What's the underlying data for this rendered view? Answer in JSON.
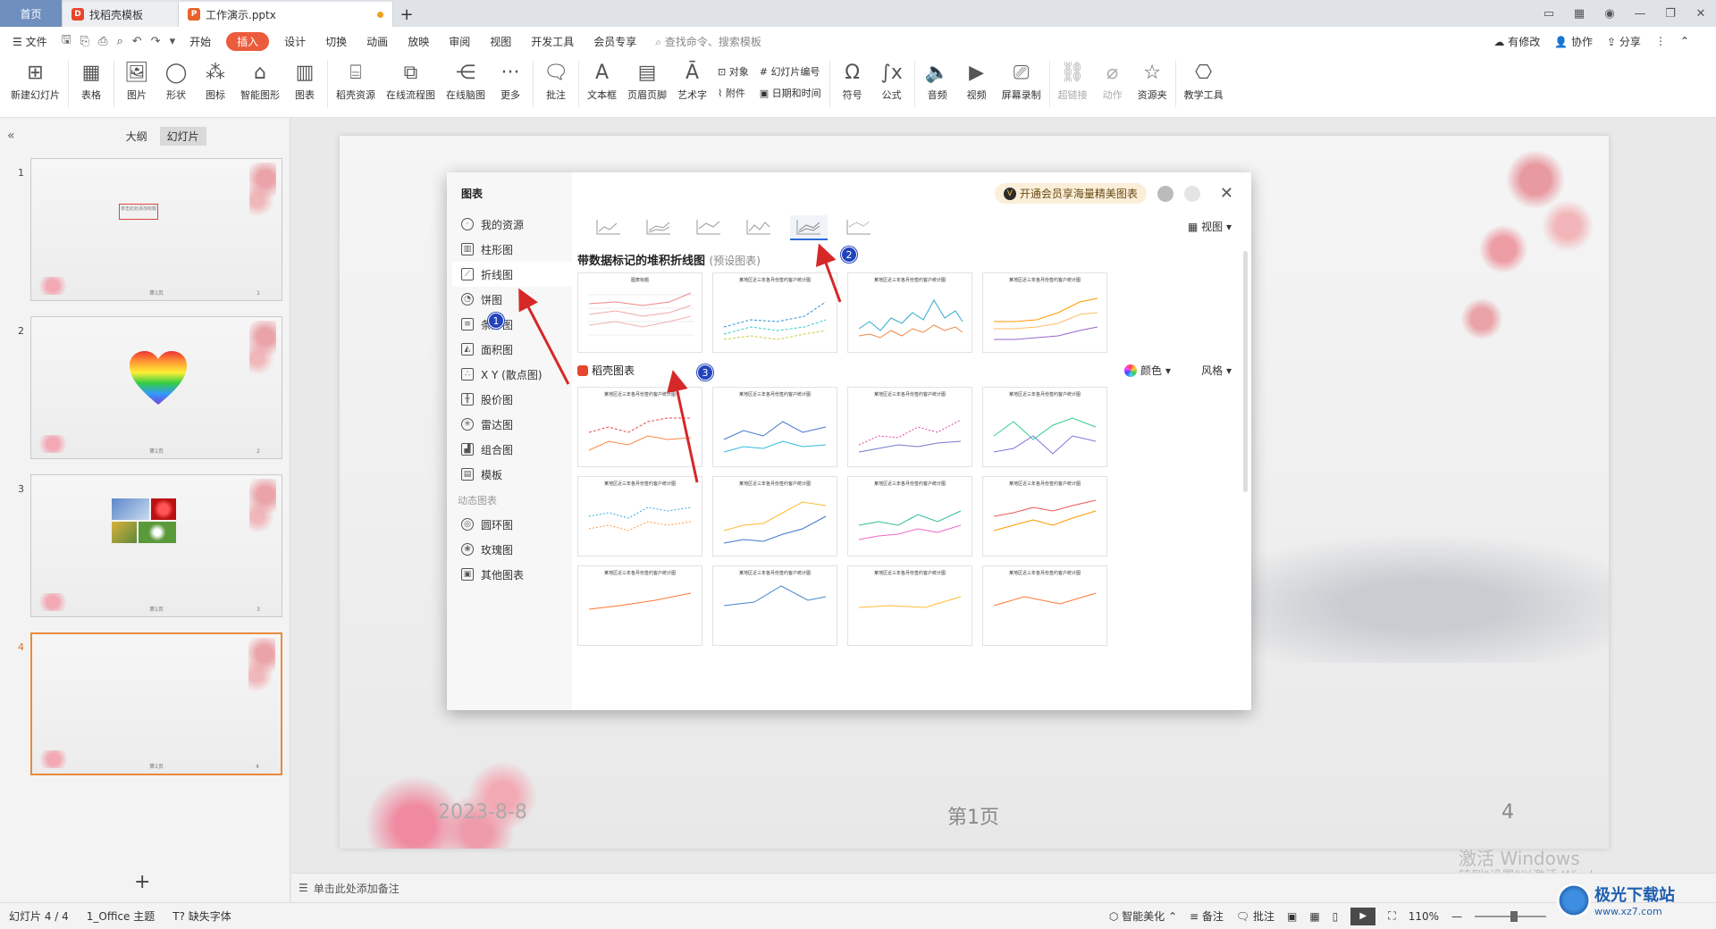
{
  "tabs": {
    "home": "首页",
    "template": "找稻壳模板",
    "doc": "工作演示.pptx",
    "new": "+"
  },
  "menu": {
    "file": "文件",
    "items": [
      "开始",
      "插入",
      "设计",
      "切换",
      "动画",
      "放映",
      "审阅",
      "视图",
      "开发工具",
      "会员专享"
    ],
    "active": "插入",
    "search": "查找命令、搜索模板",
    "right": [
      "有修改",
      "协作",
      "分享"
    ]
  },
  "ribbon": {
    "new_slide": "新建幻灯片",
    "table": "表格",
    "picture": "图片",
    "shape": "形状",
    "icon": "图标",
    "smartart": "智能图形",
    "chart": "图表",
    "daoke": "稻壳资源",
    "flowchart": "在线流程图",
    "mindmap": "在线脑图",
    "more": "更多",
    "comment": "批注",
    "textbox": "文本框",
    "header_footer": "页眉页脚",
    "wordart": "艺术字",
    "object": "对象",
    "attachment": "附件",
    "slide_number": "幻灯片编号",
    "datetime": "日期和时间",
    "symbol": "符号",
    "formula": "公式",
    "audio": "音频",
    "video": "视频",
    "screen_record": "屏幕录制",
    "hyperlink": "超链接",
    "action": "动作",
    "resource": "资源夹",
    "teaching": "教学工具"
  },
  "leftpane": {
    "outline": "大纲",
    "slides": "幻灯片",
    "slide_nums": [
      "1",
      "2",
      "3",
      "4"
    ],
    "thumb_text": "单击此处添加标题",
    "thumb_foot": "第1页"
  },
  "slide": {
    "date": "2023-8-8",
    "page": "第1页",
    "num": "4"
  },
  "watermark": {
    "line1": "激活 Windows",
    "line2": "转到\"设置\"以激活 Windows。"
  },
  "notes": "单击此处添加备注",
  "status": {
    "slide_count": "幻灯片 4 / 4",
    "theme": "1_Office 主题",
    "missing_font": "缺失字体",
    "beautify": "智能美化",
    "notes_btn": "备注",
    "comment_btn": "批注",
    "zoom": "110%"
  },
  "site": {
    "name": "极光下载站",
    "url": "www.xz7.com"
  },
  "dialog": {
    "title": "图表",
    "categories": [
      "我的资源",
      "柱形图",
      "折线图",
      "饼图",
      "条形图",
      "面积图",
      "X Y (散点图)",
      "股价图",
      "雷达图",
      "组合图",
      "模板"
    ],
    "selected": "折线图",
    "dynamic_label": "动态图表",
    "dynamic": [
      "圆环图",
      "玫瑰图",
      "其他图表"
    ],
    "vip": "开通会员享海量精美图表",
    "view": "视图",
    "section_title": "带数据标记的堆积折线图",
    "section_sub": "(预设图表)",
    "daoke_title": "稻壳图表",
    "color": "颜色",
    "style": "风格",
    "preset_card_title": "图表标题",
    "card_title": "某地区近三年各月份签约客户统计图"
  },
  "annotations": [
    "1",
    "2",
    "3"
  ]
}
